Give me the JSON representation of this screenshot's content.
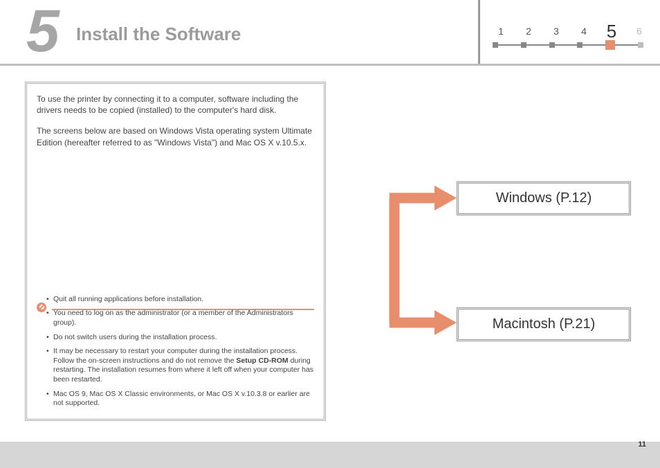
{
  "section_number": "5",
  "title": "Install the Software",
  "steps": {
    "labels": [
      "1",
      "2",
      "3",
      "4",
      "5",
      "6"
    ],
    "current_index": 4
  },
  "intro": {
    "p1": "To use the printer by connecting it to a computer, software including the drivers needs to be copied (installed) to the computer's hard disk.",
    "p2": "The screens below are based on Windows Vista operating system Ultimate Edition (hereafter referred to as \"Windows Vista\") and Mac OS X v.10.5.x."
  },
  "notes": {
    "n1": "Quit all running applications before installation.",
    "n2": "You need to log on as the administrator (or a member of the Administrators group).",
    "n3": "Do not switch users during the installation process.",
    "n4_pre": "It may be necessary to restart your computer during the installation process. Follow the on-screen instructions and do not remove the ",
    "n4_strong": "Setup CD-ROM",
    "n4_post": " during restarting. The installation resumes from where it left off when your computer has been restarted.",
    "n5": "Mac OS 9, Mac OS X Classic environments, or Mac OS X v.10.3.8 or earlier are not supported."
  },
  "branches": {
    "windows": "Windows (P.12)",
    "macintosh": "Macintosh (P.21)"
  },
  "page_number": "11",
  "accent_color": "#e98e6c"
}
